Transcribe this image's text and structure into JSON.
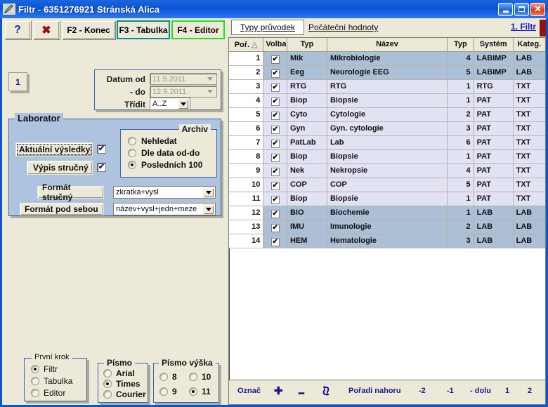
{
  "window": {
    "title": "Filtr - 6351276921 Stránská Alica",
    "icon": "pen-icon",
    "minimize_label": "",
    "maximize_label": "",
    "close_label": "✕"
  },
  "toolbar": {
    "help_label": "?",
    "close_label": "✖",
    "konec_label": "F2 - Konec",
    "tabulka_label": "F3 - Tabulka",
    "editor_label": "F4 - Editor",
    "tabulka_border_color": "#0a8a95",
    "editor_border_color": "#22e022"
  },
  "left": {
    "step_button_label": "1",
    "date_group": {
      "datum_od_label": "Datum od",
      "datum_od_value": "11.9.2011",
      "do_label": "- do",
      "do_value": "12.9.2011",
      "tridit_label": "Třídit",
      "tridit_value": "A..Z"
    },
    "laborator": {
      "title": "Laborator",
      "aktualni_vysledky_label": "Aktuální výsledky",
      "aktualni_vysledky_checked": "✔",
      "vypis_strucny_label": "Výpis stručný",
      "vypis_strucny_checked": "✔",
      "format_strucny_label": "Formát stručný",
      "format_strucny_value": "zkratka+vysl",
      "format_pod_sebou_label": "Formát pod sebou",
      "format_pod_sebou_value": "název+vysl+jedn+meze",
      "archiv": {
        "title": "Archiv",
        "options": [
          {
            "label": "Nehledat",
            "selected": false
          },
          {
            "label": "Dle data od-do",
            "selected": false
          },
          {
            "label": "Posledních 100",
            "selected": true
          }
        ]
      }
    },
    "prvni_krok": {
      "title": "První krok",
      "options": [
        {
          "label": "Filtr",
          "selected": true
        },
        {
          "label": "Tabulka",
          "selected": false
        },
        {
          "label": "Editor",
          "selected": false
        }
      ]
    },
    "pismo": {
      "title": "Písmo",
      "options": [
        {
          "label": "Arial",
          "selected": false
        },
        {
          "label": "Times",
          "selected": true
        },
        {
          "label": "Courier",
          "selected": false
        }
      ]
    },
    "pismo_vyska": {
      "title": "Písmo výška",
      "options": [
        {
          "label": "8",
          "selected": false
        },
        {
          "label": "10",
          "selected": false
        },
        {
          "label": "9",
          "selected": false
        },
        {
          "label": "11",
          "selected": true
        }
      ]
    }
  },
  "right": {
    "tabs": [
      {
        "label": "Typy průvodek",
        "active": true
      },
      {
        "label": "Počáteční hodnoty",
        "active": false
      }
    ],
    "filtr_link": "1.  Filtr",
    "table": {
      "columns": [
        "Poř.",
        "Volba",
        "Typ",
        "Název",
        "Typ",
        "Systém",
        "Kateg."
      ],
      "sort_indicator": "△",
      "rows": [
        {
          "por": "1",
          "volba": "✔",
          "typ": "Mik",
          "nazev": "Mikrobiologie",
          "typ2": "4",
          "system": "LABIMP",
          "kateg": "LAB",
          "style": "sel"
        },
        {
          "por": "2",
          "volba": "✔",
          "typ": "Eeg",
          "nazev": "Neurologie EEG",
          "typ2": "5",
          "system": "LABIMP",
          "kateg": "LAB",
          "style": "sel"
        },
        {
          "por": "3",
          "volba": "✔",
          "typ": "RTG",
          "nazev": "RTG",
          "typ2": "1",
          "system": "RTG",
          "kateg": "TXT",
          "style": "alt"
        },
        {
          "por": "4",
          "volba": "✔",
          "typ": "Biop",
          "nazev": "Biopsie",
          "typ2": "1",
          "system": "PAT",
          "kateg": "TXT",
          "style": "alt"
        },
        {
          "por": "5",
          "volba": "✔",
          "typ": "Cyto",
          "nazev": "Cytologie",
          "typ2": "2",
          "system": "PAT",
          "kateg": "TXT",
          "style": "alt"
        },
        {
          "por": "6",
          "volba": "✔",
          "typ": "Gyn",
          "nazev": "Gyn. cytologie",
          "typ2": "3",
          "system": "PAT",
          "kateg": "TXT",
          "style": "alt"
        },
        {
          "por": "7",
          "volba": "✔",
          "typ": "PatLab",
          "nazev": "Lab",
          "typ2": "6",
          "system": "PAT",
          "kateg": "TXT",
          "style": "alt"
        },
        {
          "por": "8",
          "volba": "✔",
          "typ": "Biop",
          "nazev": "Biopsie",
          "typ2": "1",
          "system": "PAT",
          "kateg": "TXT",
          "style": "alt"
        },
        {
          "por": "9",
          "volba": "✔",
          "typ": "Nek",
          "nazev": "Nekropsie",
          "typ2": "4",
          "system": "PAT",
          "kateg": "TXT",
          "style": "alt"
        },
        {
          "por": "10",
          "volba": "✔",
          "typ": "COP",
          "nazev": "COP",
          "typ2": "5",
          "system": "PAT",
          "kateg": "TXT",
          "style": "alt"
        },
        {
          "por": "11",
          "volba": "✔",
          "typ": "Biop",
          "nazev": "Biopsie",
          "typ2": "1",
          "system": "PAT",
          "kateg": "TXT",
          "style": "alt"
        },
        {
          "por": "12",
          "volba": "✔",
          "typ": "BIO",
          "nazev": "Biochemie",
          "typ2": "1",
          "system": "LAB",
          "kateg": "LAB",
          "style": "sel"
        },
        {
          "por": "13",
          "volba": "✔",
          "typ": "IMU",
          "nazev": "Imunologie",
          "typ2": "2",
          "system": "LAB",
          "kateg": "LAB",
          "style": "sel"
        },
        {
          "por": "14",
          "volba": "✔",
          "typ": "HEM",
          "nazev": "Hematologie",
          "typ2": "3",
          "system": "LAB",
          "kateg": "LAB",
          "style": "sel"
        }
      ]
    },
    "bottom_bar": {
      "oznac_label": "Označ",
      "plus_label": "✚",
      "minus_label": "━",
      "swap_icon": "refresh-swap-icon",
      "poradi_label": "Pořadí nahoru",
      "minus2_label": "-2",
      "minus1_label": "-1",
      "dolu_label": "- dolu",
      "one_label": "1",
      "two_label": "2"
    }
  }
}
